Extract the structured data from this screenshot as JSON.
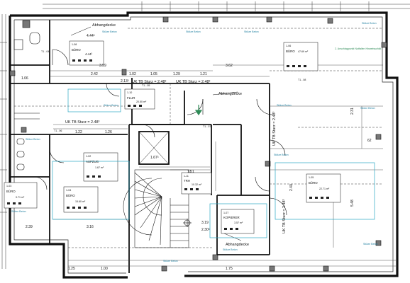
{
  "labels": {
    "abhangdecke_top": "Abhangdecke",
    "abhangdecke_mid": "Abhangdecke",
    "abhangdecke_bottom": "Abhangdecke",
    "uk_tb_sturz_1": "UK TB Sturz = 2.48³",
    "uk_tb_sturz_2": "UK TB Sturz = 2.48³",
    "uk_tb_sturz_3": "UK TB Sturz = 2.48³",
    "uk_tb_sturz_vertical_1": "UK TB Sturz = 2.48³",
    "uk_tb_sturz_vertical_2": "UK TB Sturz = 2.48³",
    "t1_04": "T1 - 04",
    "t1_05": "T1 - 05",
    "t1_06": "T1 - 06",
    "t1_07": "T1 - 07",
    "t1_08": "T1 - 08"
  },
  "rooms": [
    {
      "id": "1-08",
      "name": "BÜRO",
      "area": "4.44³"
    },
    {
      "id": "1-06",
      "name": "BÜRO",
      "area": "47.69 m²"
    },
    {
      "id": "1-10",
      "name": "FLUR",
      "area": "20.50 m²"
    },
    {
      "id": "1-02",
      "name": "AUFZUG",
      "area": "1.67 m²"
    },
    {
      "id": "1-04",
      "name": "BÜRO",
      "area": "15.60 m²"
    },
    {
      "id": "1-03",
      "name": "BÜRO",
      "area": "9.71 m²"
    },
    {
      "id": "1-05",
      "name": "BÜRO",
      "area": "22.71 m²"
    },
    {
      "id": "1-07",
      "name": "KOPIERER",
      "area": "3.57 m²"
    },
    {
      "id": "1-11",
      "name": "TRH",
      "area": "10.32 m²"
    }
  ],
  "dims": {
    "d_2_42": "2.42",
    "d_1_02": "1.02",
    "d_1_05": "1.05",
    "d_1_29": "1.29",
    "d_1_21": "1.21",
    "d_3_62": "3.62",
    "d_3_59": "3.59",
    "d_4_44": "4.44³",
    "d_2_13": "2.13³",
    "d_1_22": "1.22",
    "d_1_26": "1.26",
    "d_2_31": "2.31",
    "d_5_48": "5.48",
    "d_1_67": "1.67³",
    "d_1_51": "1.51",
    "d_2_39": "2.39",
    "d_3_16": "3.16",
    "d_1_25": "1.25",
    "d_1_00": "1.00",
    "d_1_75": "1.75",
    "d_3_19": "3.19",
    "d_2_30": "2.30³",
    "d_0_62": "62",
    "d_2_40": "2.40",
    "d_1_06": "1.06"
  },
  "notes": {
    "stuetze": "Stütze Beton",
    "note_right": "2. Anschlagpunkt Notfallen Hinweisschild"
  }
}
